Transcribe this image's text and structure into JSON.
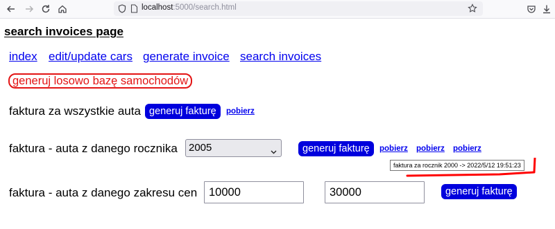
{
  "browser": {
    "url_host": "localhost",
    "url_path": ":5000/search.html"
  },
  "page": {
    "title": "search invoices page"
  },
  "nav": {
    "items": [
      "index",
      "edit/update cars",
      "generate invoice",
      "search invoices"
    ]
  },
  "actions": {
    "generate_db_label": "generuj losowo bazę samochodów"
  },
  "sections": {
    "all_cars": {
      "label": "faktura za wszystkie auta",
      "button": "generuj fakturę",
      "links": [
        "pobierz"
      ]
    },
    "by_year": {
      "label": "faktura - auta z danego rocznika",
      "selected_year": "2005",
      "button": "generuj fakturę",
      "links": [
        "pobierz",
        "pobierz",
        "pobierz"
      ],
      "tooltip": "faktura za rocznik 2000 -> 2022/5/12 19:51:23"
    },
    "by_price": {
      "label": "faktura - auta z danego zakresu cen",
      "min_value": "10000",
      "max_value": "30000",
      "button": "generuj fakturę"
    }
  },
  "colors": {
    "link": "#0000ee",
    "primary_button": "#0000dd",
    "danger": "#e31414",
    "annotation": "#ff0000"
  }
}
